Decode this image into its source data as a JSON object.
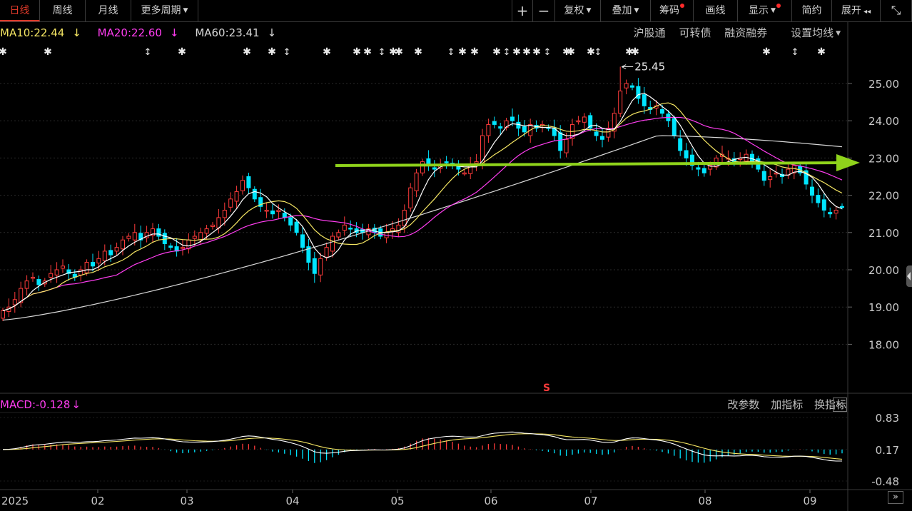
{
  "toolbar": {
    "left_tabs": [
      {
        "label": "日线",
        "active": true
      },
      {
        "label": "周线",
        "active": false
      },
      {
        "label": "月线",
        "active": false
      },
      {
        "label": "更多周期",
        "active": false
      }
    ],
    "right_items": [
      {
        "label": "+",
        "caret": false,
        "dot": false
      },
      {
        "label": "−",
        "caret": false,
        "dot": false
      },
      {
        "label": "复权",
        "caret": true,
        "dot": false
      },
      {
        "label": "叠加",
        "caret": true,
        "dot": false
      },
      {
        "label": "筹码",
        "caret": false,
        "dot": true
      },
      {
        "label": "画线",
        "caret": false,
        "dot": false
      },
      {
        "label": "显示",
        "caret": true,
        "dot": true
      },
      {
        "label": "简约",
        "caret": false,
        "dot": false
      },
      {
        "label": "展开",
        "caret": false,
        "dot": false,
        "icon": "double-chevron-left-icon"
      },
      {
        "label": "",
        "icon": "shrink-icon"
      }
    ]
  },
  "ma_legend": {
    "ma10": "MA10:22.44",
    "ma20": "MA20:22.60",
    "ma60": "MA60:23.41",
    "arrow": "↓",
    "colors": {
      "ma10": "#f5e663",
      "ma20": "#ff3df0",
      "ma60": "#d8d8d8"
    }
  },
  "top_links": [
    "沪股通",
    "可转债",
    "融资融券",
    "设置均线"
  ],
  "price_axis": {
    "labels": [
      "25.00",
      "24.00",
      "23.00",
      "22.00",
      "21.00",
      "20.00",
      "19.00",
      "18.00"
    ],
    "values": [
      25,
      24,
      23,
      22,
      21,
      20,
      19,
      18
    ]
  },
  "high_marker": "25.45",
  "signal_mark": "S",
  "macd_legend": "MACD:-0.128",
  "macd_arrow": "↓",
  "macd_controls": [
    "改参数",
    "加指标",
    "换指标"
  ],
  "macd_close": "×",
  "macd_axis": {
    "labels": [
      "0.83",
      "0.17",
      "-0.48"
    ],
    "values": [
      0.83,
      0.17,
      -0.48
    ]
  },
  "time_axis": [
    "2025",
    "02",
    "03",
    "04",
    "05",
    "06",
    "07",
    "08",
    "09"
  ],
  "colors": {
    "up": "#ff3b3b",
    "down": "#00e5ff",
    "trend_arrow": "#8fd31b",
    "bg": "#000000",
    "grid": "#2a2a2a"
  },
  "chart_data": {
    "type": "candlestick",
    "series": [
      {
        "name": "MA10",
        "value": 22.44
      },
      {
        "name": "MA20",
        "value": 22.6
      },
      {
        "name": "MA60",
        "value": 23.41
      }
    ],
    "high": 25.45,
    "close_series": [
      18.9,
      19.0,
      19.2,
      19.5,
      19.7,
      19.8,
      19.6,
      19.7,
      19.9,
      20.0,
      20.1,
      19.9,
      19.8,
      20.0,
      20.2,
      20.1,
      20.3,
      20.5,
      20.4,
      20.6,
      20.8,
      20.9,
      21.0,
      20.8,
      21.0,
      21.1,
      20.9,
      20.7,
      20.6,
      20.5,
      20.6,
      20.8,
      20.9,
      21.0,
      21.1,
      21.2,
      21.4,
      21.6,
      21.9,
      22.1,
      22.4,
      22.2,
      21.9,
      21.7,
      21.6,
      21.5,
      21.6,
      21.4,
      21.2,
      21.0,
      20.6,
      20.2,
      19.9,
      20.3,
      20.6,
      20.9,
      21.0,
      21.2,
      21.1,
      21.0,
      21.0,
      21.1,
      21.0,
      20.9,
      21.0,
      21.1,
      21.2,
      21.6,
      22.2,
      22.6,
      22.9,
      22.8,
      22.7,
      22.8,
      22.9,
      22.8,
      22.7,
      22.6,
      22.8,
      22.9,
      23.6,
      23.9,
      23.9,
      23.8,
      24.0,
      24.0,
      23.8,
      23.7,
      23.9,
      23.8,
      23.9,
      23.8,
      23.6,
      23.2,
      23.5,
      23.9,
      24.0,
      24.1,
      23.8,
      23.6,
      23.5,
      23.8,
      24.2,
      24.8,
      25.0,
      24.9,
      24.6,
      24.4,
      24.3,
      24.4,
      24.2,
      24.0,
      23.6,
      23.2,
      23.0,
      22.8,
      22.7,
      22.6,
      22.8,
      23.0,
      23.1,
      23.0,
      22.9,
      23.0,
      23.1,
      22.9,
      22.7,
      22.4,
      22.5,
      22.6,
      22.5,
      22.7,
      22.8,
      22.6,
      22.3,
      22.0,
      21.8,
      21.6,
      21.5,
      21.6,
      21.7
    ],
    "macd": -0.128
  }
}
